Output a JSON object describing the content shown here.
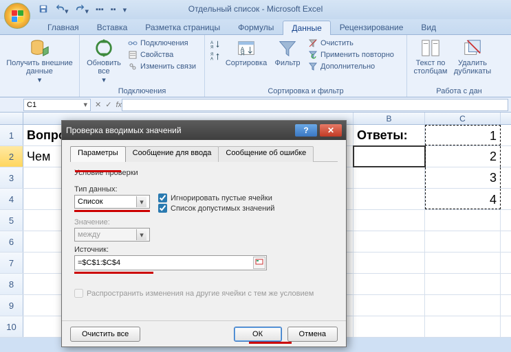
{
  "app_title": "Отдельный список - Microsoft Excel",
  "tabs": {
    "home": "Главная",
    "insert": "Вставка",
    "page_layout": "Разметка страницы",
    "formulas": "Формулы",
    "data": "Данные",
    "review": "Рецензирование",
    "view": "Вид"
  },
  "ribbon": {
    "get_external": "Получить внешние данные",
    "refresh_all": "Обновить все",
    "connections": "Подключения",
    "properties": "Свойства",
    "edit_links": "Изменить связи",
    "group_connections": "Подключения",
    "sort_az": "А↓Я",
    "sort_za": "Я↓А",
    "sort": "Сортировка",
    "filter": "Фильтр",
    "clear": "Очистить",
    "reapply": "Применить повторно",
    "advanced": "Дополнительно",
    "group_sortfilter": "Сортировка и фильтр",
    "text_to_cols": "Текст по столбцам",
    "remove_dup": "Удалить дубликаты",
    "group_datatools": "Работа с дан"
  },
  "namebox": "C1",
  "sheet": {
    "colB": "B",
    "colC": "C",
    "a1": "Вопросы:",
    "b1": "Ответы:",
    "c1": "1",
    "a2": "Чем",
    "c2": "2",
    "c3": "3",
    "c4": "4"
  },
  "dialog": {
    "title": "Проверка вводимых значений",
    "tab_params": "Параметры",
    "tab_input": "Сообщение для ввода",
    "tab_error": "Сообщение об ошибке",
    "cond_title": "Условие проверки",
    "type_label": "Тип данных:",
    "type_value": "Список",
    "ignore_blank": "Игнорировать пустые ячейки",
    "dropdown_list": "Список допустимых значений",
    "value_label": "Значение:",
    "value_value": "между",
    "source_label": "Источник:",
    "source_value": "=$C$1:$C$4",
    "propagate": "Распространить изменения на другие ячейки с тем же условием",
    "clear_all": "Очистить все",
    "ok": "ОК",
    "cancel": "Отмена"
  }
}
